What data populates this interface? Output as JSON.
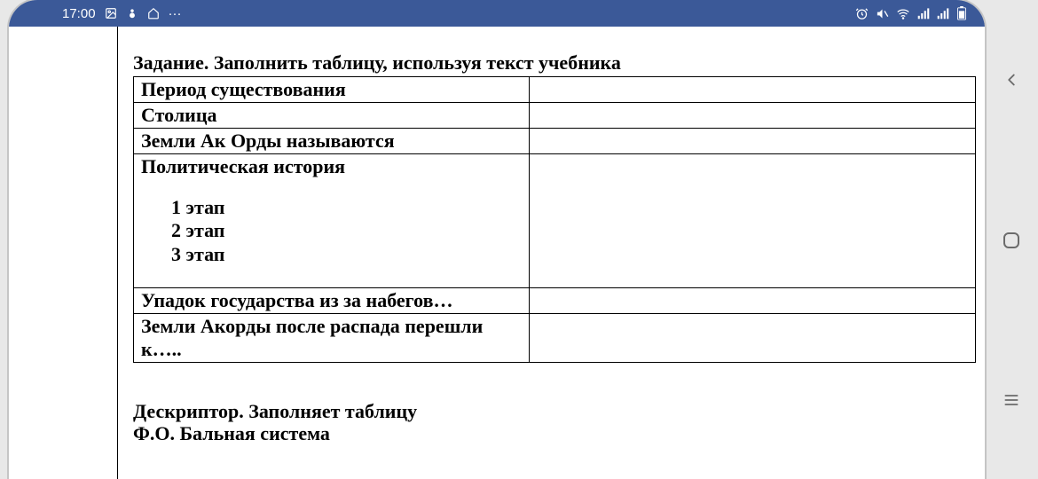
{
  "status": {
    "time": "17:00",
    "dots": "···"
  },
  "task": {
    "title": "Задание.  Заполнить таблицу, используя текст учебника",
    "rows": {
      "0": {
        "label": "Период существования",
        "value": ""
      },
      "1": {
        "label": "Столица",
        "value": ""
      },
      "2": {
        "label": "Земли Ак Орды называются",
        "value": ""
      },
      "3": {
        "label": "Политическая история",
        "stages": {
          "0": "1 этап",
          "1": "2 этап",
          "2": "3 этап"
        },
        "value": ""
      },
      "4": {
        "label": "Упадок государства из за набегов…",
        "value": ""
      },
      "5": {
        "label": "Земли Акорды после распада перешли к…..",
        "value": ""
      }
    }
  },
  "descriptor": {
    "line1": "Дескриптор. Заполняет таблицу",
    "line2": "Ф.О. Бальная система"
  }
}
